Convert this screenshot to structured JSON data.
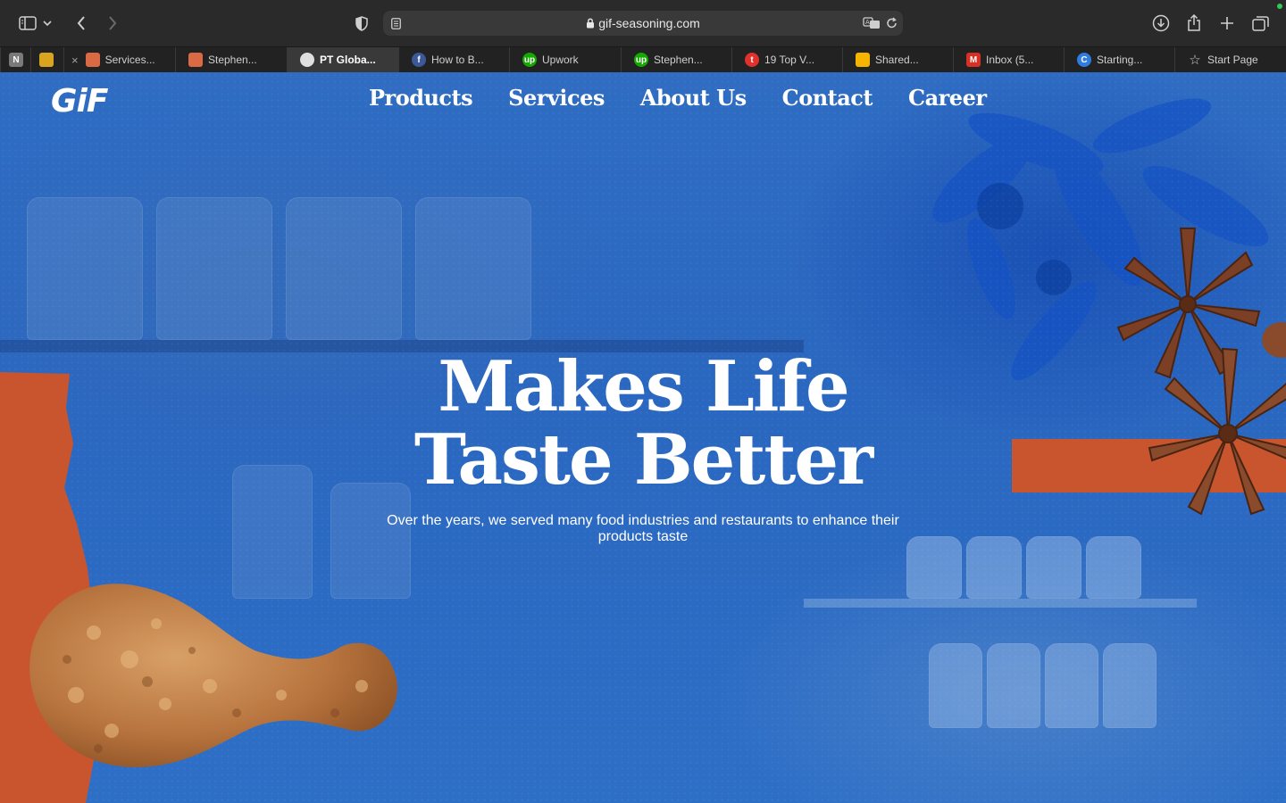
{
  "browser": {
    "url": "gif-seasoning.com",
    "tabs": [
      {
        "label": "",
        "icon": "notion-icon",
        "color": "#7a7a7a",
        "glyph": "N"
      },
      {
        "label": "",
        "icon": "emoji-icon",
        "color": "#d9a520",
        "glyph": ""
      },
      {
        "label": "Services...",
        "icon": "pen-icon",
        "color": "#d96a44",
        "glyph": ""
      },
      {
        "label": "Stephen...",
        "icon": "pen-icon",
        "color": "#d96a44",
        "glyph": ""
      },
      {
        "label": "PT Globa...",
        "icon": "brand-icon",
        "color": "#e0e0e0",
        "glyph": ""
      },
      {
        "label": "How to B...",
        "icon": "facebook-icon",
        "color": "#3b5998",
        "glyph": "f"
      },
      {
        "label": "Upwork",
        "icon": "upwork-icon",
        "color": "#14a800",
        "glyph": "up"
      },
      {
        "label": "Stephen...",
        "icon": "upwork-icon",
        "color": "#14a800",
        "glyph": "up"
      },
      {
        "label": "19 Top V...",
        "icon": "brand-icon",
        "color": "#e0322b",
        "glyph": "t"
      },
      {
        "label": "Shared...",
        "icon": "google-drive-icon",
        "color": "#f4b400",
        "glyph": ""
      },
      {
        "label": "Inbox (5...",
        "icon": "gmail-icon",
        "color": "#d93025",
        "glyph": "M"
      },
      {
        "label": "Starting...",
        "icon": "brand-icon",
        "color": "#2f7de1",
        "glyph": "C"
      },
      {
        "label": "Start Page",
        "icon": "star-icon",
        "color": "#cfcfcf",
        "glyph": "☆"
      }
    ]
  },
  "site": {
    "logo": "GiF",
    "nav": [
      "Products",
      "Services",
      "About Us",
      "Contact",
      "Career"
    ],
    "headline_line1": "Makes Life",
    "headline_line2": "Taste Better",
    "subheadline": "Over the years, we served many food industries and restaurants to enhance their products taste"
  },
  "colors": {
    "hero_blue": "#2a67c0",
    "accent_orange": "#c9552f"
  }
}
